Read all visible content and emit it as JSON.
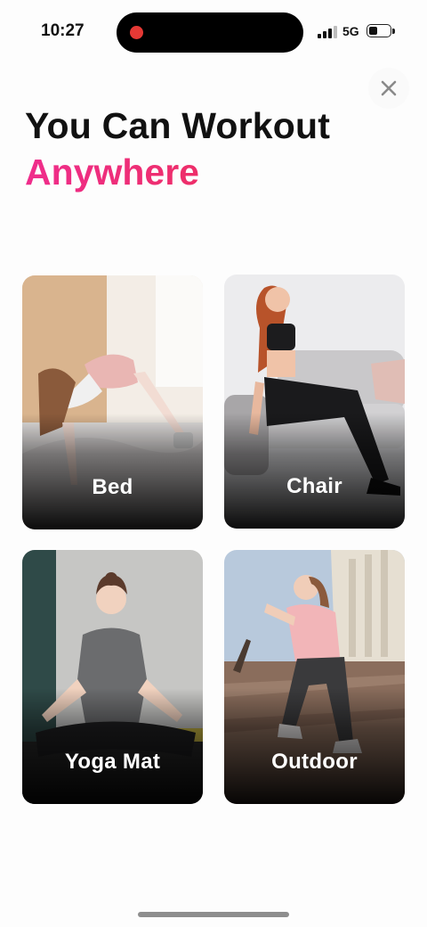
{
  "status_bar": {
    "time": "10:27",
    "network": "5G",
    "icons": [
      "recording-dot-icon",
      "signal-icon",
      "battery-icon"
    ]
  },
  "header": {
    "close_icon": "close-icon",
    "title_line1": "You Can Workout",
    "title_line2": "Anywhere",
    "accent_gradient": [
      "#ef2d8c",
      "#ec2f4f"
    ]
  },
  "locations": [
    {
      "label": "Bed"
    },
    {
      "label": "Chair"
    },
    {
      "label": "Yoga Mat"
    },
    {
      "label": "Outdoor"
    }
  ],
  "colors": {
    "background": "#fdfdfd",
    "title": "#111111",
    "card_label": "#ffffff"
  }
}
